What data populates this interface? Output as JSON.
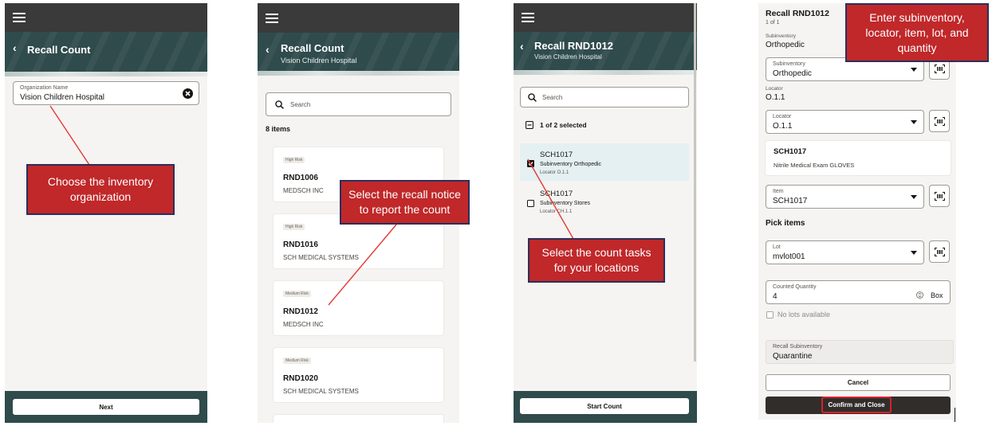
{
  "screen1": {
    "title": "Recall Count",
    "org_label": "Organization Name",
    "org_value": "Vision Children Hospital",
    "next_label": "Next",
    "callout": "Choose the inventory organization"
  },
  "screen2": {
    "title": "Recall Count",
    "subtitle": "Vision Children Hospital",
    "search_placeholder": "Search",
    "count": "8 items",
    "cards": [
      {
        "risk": "High Risk",
        "number": "RND1006",
        "supplier": "MEDSCH INC"
      },
      {
        "risk": "High Risk",
        "number": "RND1016",
        "supplier": "SCH MEDICAL SYSTEMS"
      },
      {
        "risk": "Medium Risk",
        "number": "RND1012",
        "supplier": "MEDSCH INC"
      },
      {
        "risk": "Medium Risk",
        "number": "RND1020",
        "supplier": "SCH MEDICAL SYSTEMS"
      }
    ],
    "callout": "Select the recall notice to report the count"
  },
  "screen3": {
    "title": "Recall RND1012",
    "subtitle": "Vision Children Hospital",
    "search_placeholder": "Search",
    "selected": "1 of 2 selected",
    "tasks": [
      {
        "item": "SCH1017",
        "sub": "Subinventory Orthopedic",
        "loc": "Locator O.1.1",
        "checked": true
      },
      {
        "item": "SCH1017",
        "sub": "Subinventory Stores",
        "loc": "Locator CH.1.1",
        "checked": false
      }
    ],
    "start_label": "Start Count",
    "callout": "Select the count tasks for your locations"
  },
  "screen4": {
    "title": "Recall RND1012",
    "of": "1 of 1",
    "subinv_label": "Subinventory",
    "subinv_value": "Orthopedic",
    "subinv_field_label": "Subinventory",
    "subinv_field_value": "Orthopedic",
    "locator_label": "Locator",
    "locator_value": "O.1.1",
    "locator_field_label": "Locator",
    "locator_field_value": "O.1.1",
    "item_num": "SCH1017",
    "item_desc": "Nitrile Medical Exam GLOVES",
    "item_field_label": "Item",
    "item_field_value": "SCH1017",
    "pick_items": "Pick items",
    "lot_label": "Lot",
    "lot_value": "mvlot001",
    "qty_label": "Counted Quantity",
    "qty_value": "4",
    "qty_uom": "Box",
    "no_lots": "No lots available",
    "recall_sub_label": "Recall Subinventory",
    "recall_sub_value": "Quarantine",
    "cancel_label": "Cancel",
    "confirm_label": "Confirm and Close",
    "callout": "Enter subinventory, locator, item, lot, and quantity"
  },
  "colors": {
    "header_teal": "#2f4b4c",
    "callout_red": "#c0282a",
    "topbar": "#3a3a3a"
  }
}
